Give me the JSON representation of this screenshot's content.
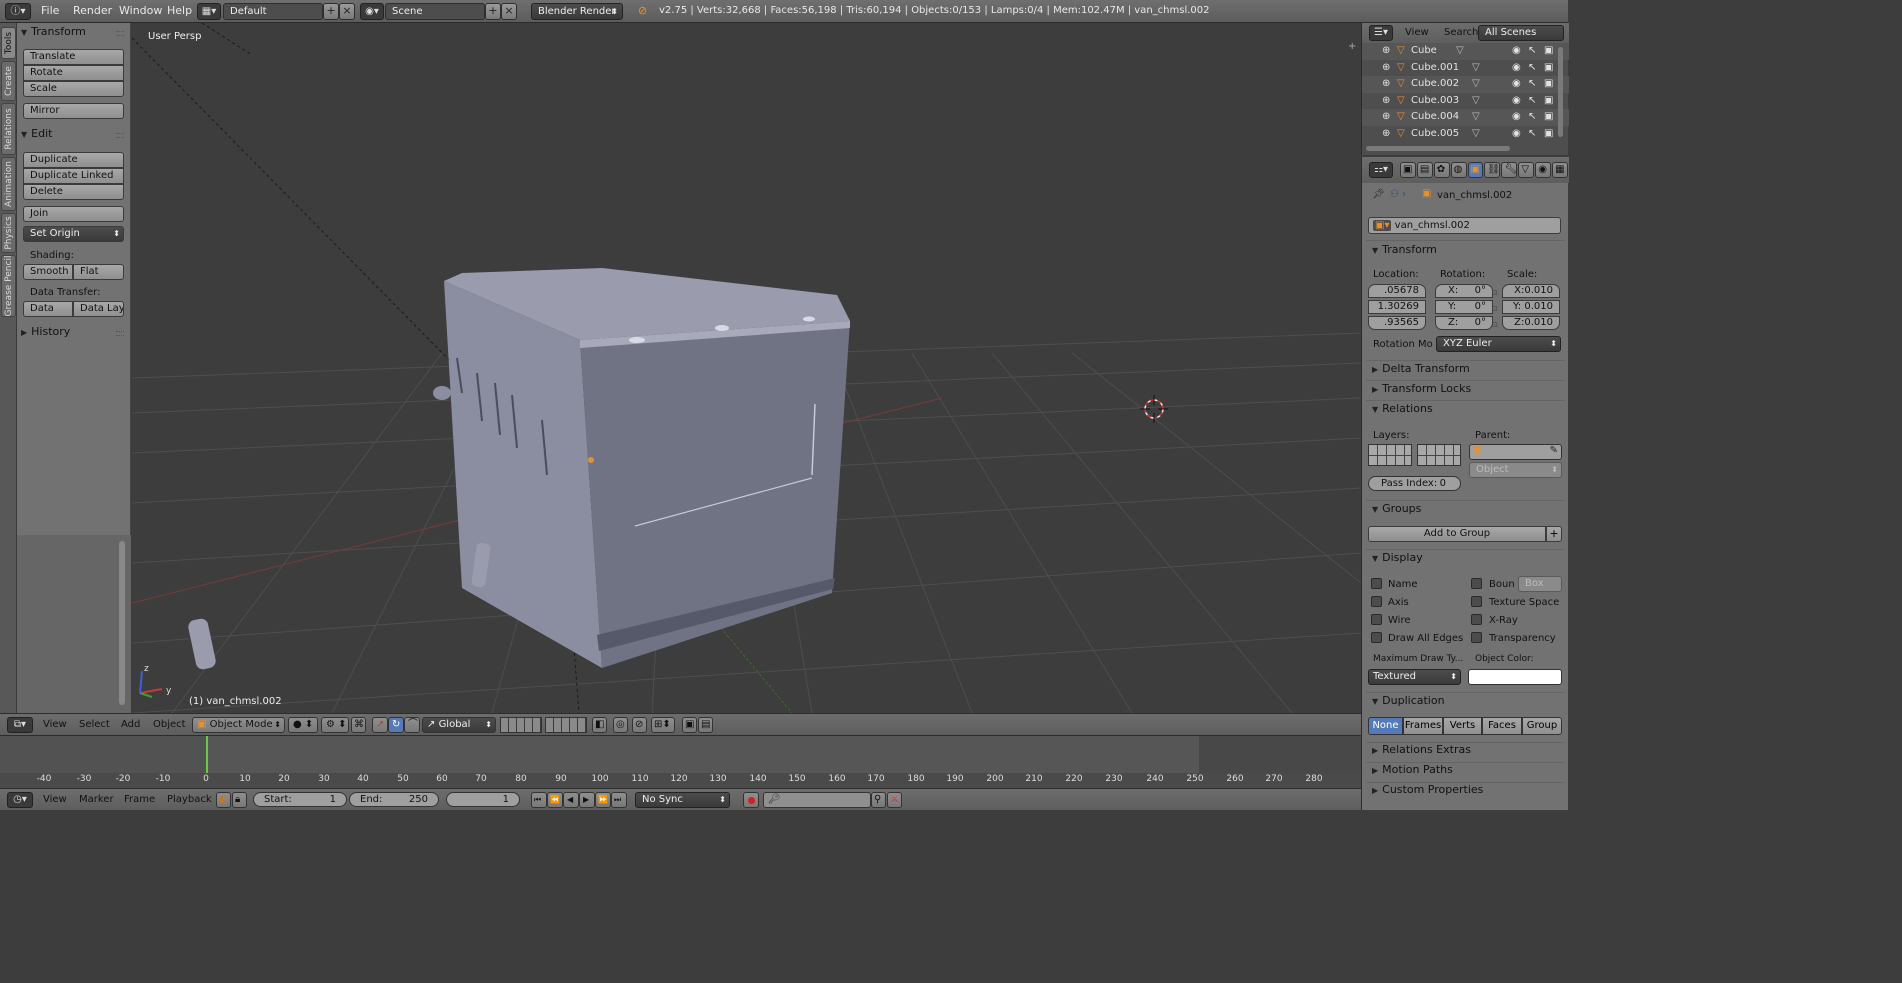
{
  "topbar": {
    "menus": [
      "File",
      "Render",
      "Window",
      "Help"
    ],
    "layout": "Default",
    "scene": "Scene",
    "engine": "Blender Render",
    "stats": "v2.75 | Verts:32,668 | Faces:56,198 | Tris:60,194 | Objects:0/153 | Lamps:0/4 | Mem:102.47M | van_chmsl.002"
  },
  "left_tabs": [
    "Tools",
    "Create",
    "Relations",
    "Animation",
    "Physics",
    "Grease Pencil"
  ],
  "toolshelf": {
    "transform_title": "Transform",
    "transform_buttons": [
      "Translate",
      "Rotate",
      "Scale"
    ],
    "mirror": "Mirror",
    "edit_title": "Edit",
    "edit_buttons": [
      "Duplicate",
      "Duplicate Linked",
      "Delete"
    ],
    "join": "Join",
    "set_origin": "Set Origin",
    "shading_label": "Shading:",
    "shading": [
      "Smooth",
      "Flat"
    ],
    "data_transfer_label": "Data Transfer:",
    "data_transfer": [
      "Data",
      "Data Layo"
    ],
    "history_title": "History"
  },
  "viewport": {
    "view_name": "User Persp",
    "active_object": "(1) van_chmsl.002"
  },
  "viewport_header": {
    "menus": [
      "View",
      "Select",
      "Add",
      "Object"
    ],
    "mode": "Object Mode",
    "orientation": "Global"
  },
  "timeline": {
    "ticks": [
      "-40",
      "-30",
      "-20",
      "-10",
      "0",
      "10",
      "20",
      "30",
      "40",
      "50",
      "60",
      "70",
      "80",
      "90",
      "100",
      "110",
      "120",
      "130",
      "140",
      "150",
      "160",
      "170",
      "180",
      "190",
      "200",
      "210",
      "220",
      "230",
      "240",
      "250",
      "260",
      "270",
      "280"
    ],
    "menus": [
      "View",
      "Marker",
      "Frame",
      "Playback"
    ],
    "start_label": "Start:",
    "start_value": "1",
    "end_label": "End:",
    "end_value": "250",
    "current": "1",
    "sync": "No Sync"
  },
  "outliner": {
    "view": "View",
    "search": "Search",
    "filter": "All Scenes",
    "items": [
      "Cube",
      "Cube.001",
      "Cube.002",
      "Cube.003",
      "Cube.004",
      "Cube.005"
    ]
  },
  "properties": {
    "breadcrumb": "van_chmsl.002",
    "object_name": "van_chmsl.002",
    "transform_title": "Transform",
    "location_label": "Location:",
    "rotation_label": "Rotation:",
    "scale_label": "Scale:",
    "location": [
      ".05678",
      "1.30269",
      ".93565"
    ],
    "rotation": [
      {
        "axis": "X:",
        "value": "0°"
      },
      {
        "axis": "Y:",
        "value": "0°"
      },
      {
        "axis": "Z:",
        "value": "0°"
      }
    ],
    "scale": [
      "X:0.010",
      "Y: 0.010",
      "Z:0.010"
    ],
    "rotation_mode_label": "Rotation Mo",
    "rotation_mode": "XYZ Euler",
    "delta_transform": "Delta Transform",
    "transform_locks": "Transform Locks",
    "relations_title": "Relations",
    "layers_label": "Layers:",
    "parent_label": "Parent:",
    "parent_type": "Object",
    "pass_index_label": "Pass Index:",
    "pass_index": "0",
    "groups_title": "Groups",
    "add_to_group": "Add to Group",
    "display_title": "Display",
    "display_left": [
      "Name",
      "Axis",
      "Wire",
      "Draw All Edges"
    ],
    "display_right": [
      "Boun",
      "Texture Space",
      "X-Ray",
      "Transparency"
    ],
    "bounds_type": "Box",
    "max_draw_label": "Maximum Draw Ty...",
    "object_color_label": "Object Color:",
    "max_draw": "Textured",
    "duplication_title": "Duplication",
    "duplication_tabs": [
      "None",
      "Frames",
      "Verts",
      "Faces",
      "Group"
    ],
    "relations_extras": "Relations Extras",
    "motion_paths": "Motion Paths",
    "custom_properties": "Custom Properties"
  }
}
